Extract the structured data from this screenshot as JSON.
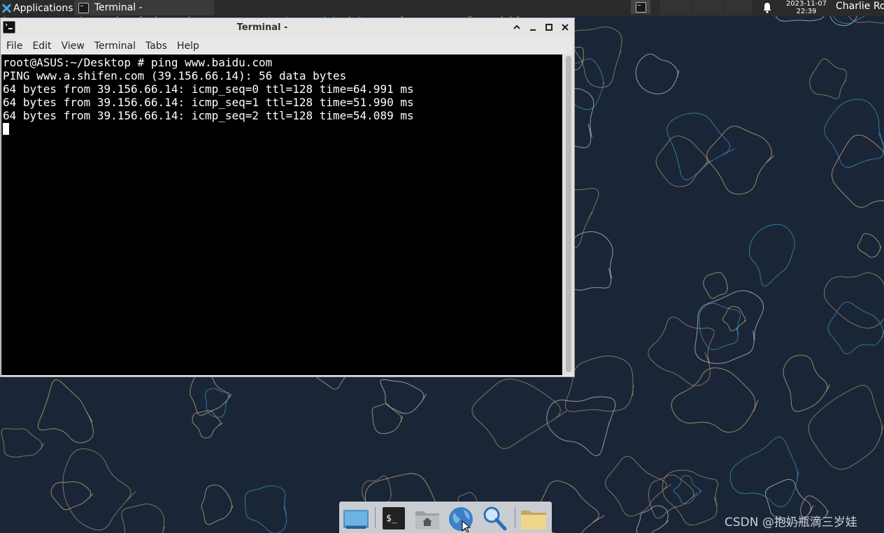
{
  "top_panel": {
    "applications_label": "Applications",
    "taskbar_terminal_label": "Terminal -",
    "clock_date": "2023-11-07",
    "clock_time": "22:39",
    "user_name": "Charlie Ro"
  },
  "window": {
    "title": "Terminal -",
    "menu": [
      "File",
      "Edit",
      "View",
      "Terminal",
      "Tabs",
      "Help"
    ]
  },
  "terminal": {
    "lines": [
      "root@ASUS:~/Desktop # ping www.baidu.com",
      "PING www.a.shifen.com (39.156.66.14): 56 data bytes",
      "64 bytes from 39.156.66.14: icmp_seq=0 ttl=128 time=64.991 ms",
      "64 bytes from 39.156.66.14: icmp_seq=1 ttl=128 time=51.990 ms",
      "64 bytes from 39.156.66.14: icmp_seq=2 ttl=128 time=54.089 ms"
    ]
  },
  "dock": {
    "items": [
      "show-desktop-icon",
      "terminal-icon",
      "home-folder-icon",
      "web-browser-icon",
      "app-finder-icon",
      "file-manager-icon"
    ]
  },
  "watermark": "CSDN @抱奶瓶滴三岁娃",
  "colors": {
    "desktop": "#1a2637",
    "terminal_bg": "#000000",
    "terminal_fg": "#ffffff",
    "accent": "#4aa3df"
  }
}
